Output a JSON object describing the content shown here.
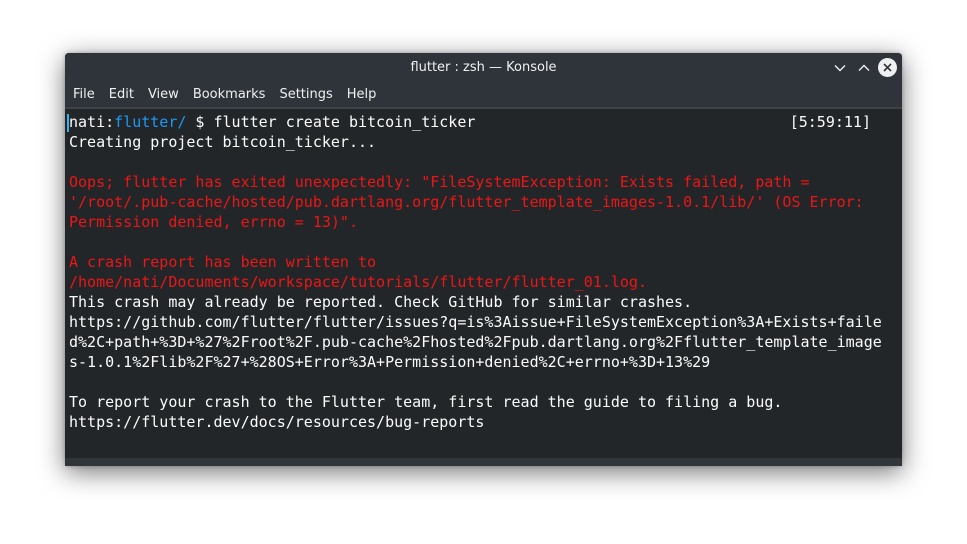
{
  "window": {
    "title": "flutter : zsh — Konsole"
  },
  "menu": [
    "File",
    "Edit",
    "View",
    "Bookmarks",
    "Settings",
    "Help"
  ],
  "terminal": {
    "prompt_user": "nati",
    "prompt_colon": ":",
    "prompt_dir": "flutter/",
    "prompt_command": " $ flutter create bitcoin_ticker",
    "clock": "[5:59:11]",
    "creating": "Creating project bitcoin_ticker...",
    "error_lines": [
      "Oops; flutter has exited unexpectedly: \"FileSystemException: Exists failed, path =",
      "'/root/.pub-cache/hosted/pub.dartlang.org/flutter_template_images-1.0.1/lib/' (OS Error:",
      "Permission denied, errno = 13)\"."
    ],
    "crash_lines": [
      "A crash report has been written to",
      "/home/nati/Documents/workspace/tutorials/flutter/flutter_01.log."
    ],
    "reported_lines": [
      "This crash may already be reported. Check GitHub for similar crashes.",
      "https://github.com/flutter/flutter/issues?q=is%3Aissue+FileSystemException%3A+Exists+faile",
      "d%2C+path+%3D+%27%2Froot%2F.pub-cache%2Fhosted%2Fpub.dartlang.org%2Fflutter_template_image",
      "s-1.0.1%2Flib%2F%27+%28OS+Error%3A+Permission+denied%2C+errno+%3D+13%29"
    ],
    "report_lines": [
      "To report your crash to the Flutter team, first read the guide to filing a bug.",
      "https://flutter.dev/docs/resources/bug-reports"
    ]
  }
}
